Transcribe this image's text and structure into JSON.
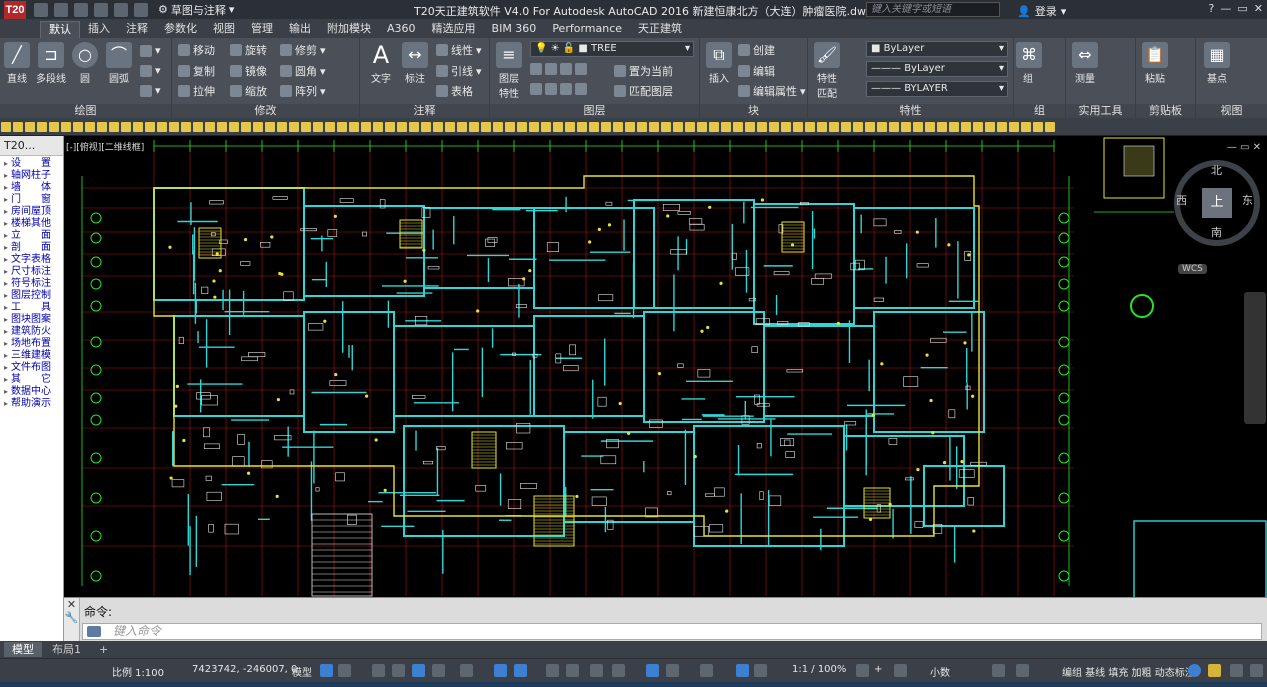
{
  "titlebar": {
    "logo": "T20",
    "workspace": "草图与注释",
    "title": "T20天正建筑软件 V4.0 For Autodesk AutoCAD 2016    新建恒康北方（大连）肿瘤医院.dwg",
    "search_placeholder": "键入关键字或短语",
    "login": "登录"
  },
  "ribbon_tabs": [
    "默认",
    "插入",
    "注释",
    "参数化",
    "视图",
    "管理",
    "输出",
    "附加模块",
    "A360",
    "精选应用",
    "BIM 360",
    "Performance",
    "天正建筑"
  ],
  "ribbon": {
    "draw": {
      "title": "绘图",
      "line": "直线",
      "polyline": "多段线",
      "circle": "圆",
      "arc": "圆弧"
    },
    "modify": {
      "title": "修改",
      "move": "移动",
      "rotate": "旋转",
      "trim": "修剪",
      "copy": "复制",
      "mirror": "镜像",
      "fillet": "圆角",
      "stretch": "拉伸",
      "scale": "缩放",
      "array": "阵列"
    },
    "annotation": {
      "title": "注释",
      "text": "文字",
      "dim": "标注",
      "linear": "线性",
      "leader": "引线",
      "table": "表格"
    },
    "layers": {
      "title": "图层",
      "props": "图层\n特性",
      "current_layer": "TREE",
      "make_current": "置为当前",
      "match_layer": "匹配图层"
    },
    "block": {
      "title": "块",
      "insert": "插入",
      "create": "创建",
      "edit": "编辑",
      "edit_attr": "编辑属性"
    },
    "properties": {
      "title": "特性",
      "match": "特性\n匹配",
      "color": "ByLayer",
      "linetype": "ByLayer",
      "lineweight": "BYLAYER"
    },
    "groups": {
      "title": "组",
      "group": "组"
    },
    "utilities": {
      "title": "实用工具",
      "measure": "测量"
    },
    "clipboard": {
      "title": "剪贴板",
      "paste": "粘贴"
    },
    "view": {
      "title": "视图",
      "base": "基点"
    }
  },
  "palette": {
    "title": "T20...",
    "items": [
      "设　　置",
      "轴网柱子",
      "墙　　体",
      "门　　窗",
      "房间屋顶",
      "楼梯其他",
      "立　　面",
      "剖　　面",
      "文字表格",
      "尺寸标注",
      "符号标注",
      "图层控制",
      "工　　具",
      "图块图案",
      "建筑防火",
      "场地布置",
      "三维建模",
      "文件布图",
      "其　　它",
      "数据中心",
      "帮助演示"
    ]
  },
  "viewport": {
    "label": "[-][俯视][二维线框]",
    "viewcube": {
      "top": "上",
      "north": "北",
      "south": "南",
      "east": "东",
      "west": "西"
    },
    "wcs": "WCS"
  },
  "command": {
    "history": "命令:",
    "placeholder": "键入命令"
  },
  "layout_tabs": [
    "模型",
    "布局1",
    "+"
  ],
  "status": {
    "scale": "比例 1:100",
    "coords": "7423742, -246007, 0",
    "model": "模型",
    "annoscale": "1:1 / 100%",
    "units": "小数",
    "tianzheng": "编组 基线 填充 加粗 动态标注"
  },
  "colors": {
    "cad_cyan": "#2fd6d6",
    "cad_green": "#23e623",
    "cad_red": "#e01c1c",
    "cad_yellow": "#e9e236",
    "cad_white": "#e8e8e8"
  }
}
